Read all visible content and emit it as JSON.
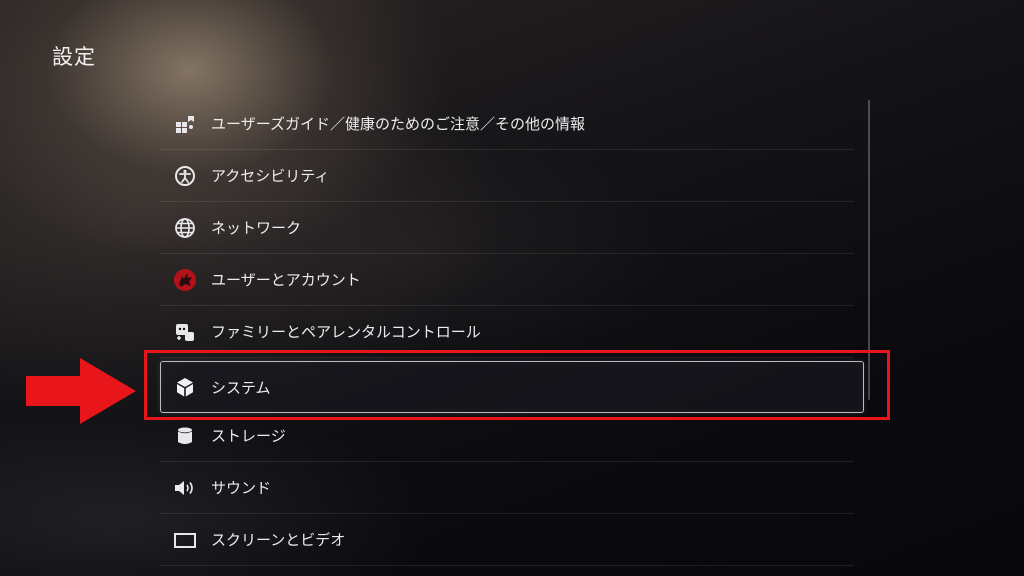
{
  "page": {
    "title": "設定"
  },
  "menu": {
    "items": [
      {
        "label": "ユーザーズガイド／健康のためのご注意／その他の情報",
        "icon": "user-guide-icon"
      },
      {
        "label": "アクセシビリティ",
        "icon": "accessibility-icon"
      },
      {
        "label": "ネットワーク",
        "icon": "globe-icon"
      },
      {
        "label": "ユーザーとアカウント",
        "icon": "user-avatar-icon"
      },
      {
        "label": "ファミリーとペアレンタルコントロール",
        "icon": "family-icon"
      },
      {
        "label": "システム",
        "icon": "cube-icon",
        "selected": true
      },
      {
        "label": "ストレージ",
        "icon": "storage-cylinder-icon"
      },
      {
        "label": "サウンド",
        "icon": "speaker-icon"
      },
      {
        "label": "スクリーンとビデオ",
        "icon": "screen-icon"
      }
    ]
  },
  "annotation": {
    "color": "#e8151b",
    "highlight": "red-box-around-system",
    "arrow": "red-arrow-pointing-right"
  },
  "colors": {
    "background": "#0c0c10",
    "text": "#ececee",
    "focus_border": "#d7d7e1"
  }
}
